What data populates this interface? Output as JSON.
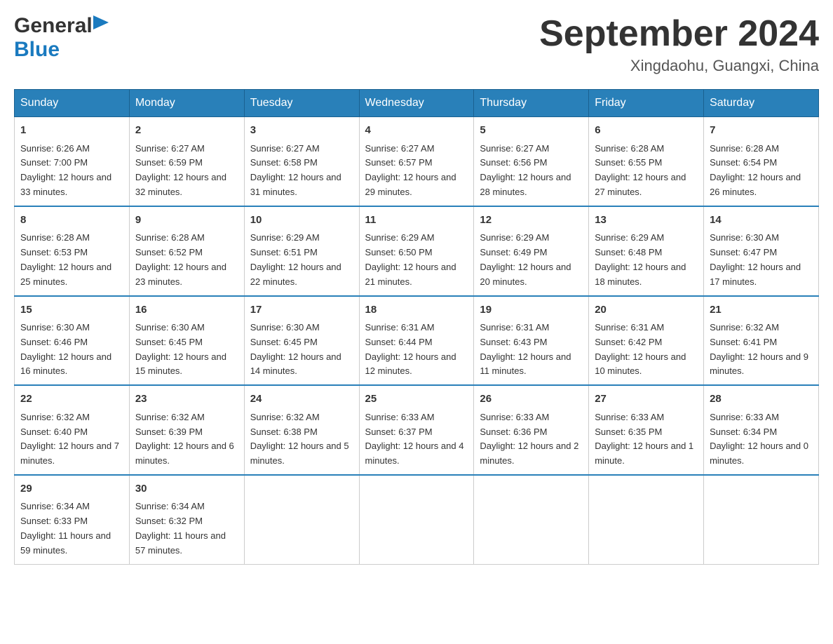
{
  "header": {
    "logo": {
      "general": "General",
      "blue": "Blue",
      "flag_unicode": "▶"
    },
    "title": "September 2024",
    "location": "Xingdaohu, Guangxi, China"
  },
  "days_of_week": [
    "Sunday",
    "Monday",
    "Tuesday",
    "Wednesday",
    "Thursday",
    "Friday",
    "Saturday"
  ],
  "weeks": [
    [
      {
        "day": "1",
        "sunrise": "6:26 AM",
        "sunset": "7:00 PM",
        "daylight": "12 hours and 33 minutes."
      },
      {
        "day": "2",
        "sunrise": "6:27 AM",
        "sunset": "6:59 PM",
        "daylight": "12 hours and 32 minutes."
      },
      {
        "day": "3",
        "sunrise": "6:27 AM",
        "sunset": "6:58 PM",
        "daylight": "12 hours and 31 minutes."
      },
      {
        "day": "4",
        "sunrise": "6:27 AM",
        "sunset": "6:57 PM",
        "daylight": "12 hours and 29 minutes."
      },
      {
        "day": "5",
        "sunrise": "6:27 AM",
        "sunset": "6:56 PM",
        "daylight": "12 hours and 28 minutes."
      },
      {
        "day": "6",
        "sunrise": "6:28 AM",
        "sunset": "6:55 PM",
        "daylight": "12 hours and 27 minutes."
      },
      {
        "day": "7",
        "sunrise": "6:28 AM",
        "sunset": "6:54 PM",
        "daylight": "12 hours and 26 minutes."
      }
    ],
    [
      {
        "day": "8",
        "sunrise": "6:28 AM",
        "sunset": "6:53 PM",
        "daylight": "12 hours and 25 minutes."
      },
      {
        "day": "9",
        "sunrise": "6:28 AM",
        "sunset": "6:52 PM",
        "daylight": "12 hours and 23 minutes."
      },
      {
        "day": "10",
        "sunrise": "6:29 AM",
        "sunset": "6:51 PM",
        "daylight": "12 hours and 22 minutes."
      },
      {
        "day": "11",
        "sunrise": "6:29 AM",
        "sunset": "6:50 PM",
        "daylight": "12 hours and 21 minutes."
      },
      {
        "day": "12",
        "sunrise": "6:29 AM",
        "sunset": "6:49 PM",
        "daylight": "12 hours and 20 minutes."
      },
      {
        "day": "13",
        "sunrise": "6:29 AM",
        "sunset": "6:48 PM",
        "daylight": "12 hours and 18 minutes."
      },
      {
        "day": "14",
        "sunrise": "6:30 AM",
        "sunset": "6:47 PM",
        "daylight": "12 hours and 17 minutes."
      }
    ],
    [
      {
        "day": "15",
        "sunrise": "6:30 AM",
        "sunset": "6:46 PM",
        "daylight": "12 hours and 16 minutes."
      },
      {
        "day": "16",
        "sunrise": "6:30 AM",
        "sunset": "6:45 PM",
        "daylight": "12 hours and 15 minutes."
      },
      {
        "day": "17",
        "sunrise": "6:30 AM",
        "sunset": "6:45 PM",
        "daylight": "12 hours and 14 minutes."
      },
      {
        "day": "18",
        "sunrise": "6:31 AM",
        "sunset": "6:44 PM",
        "daylight": "12 hours and 12 minutes."
      },
      {
        "day": "19",
        "sunrise": "6:31 AM",
        "sunset": "6:43 PM",
        "daylight": "12 hours and 11 minutes."
      },
      {
        "day": "20",
        "sunrise": "6:31 AM",
        "sunset": "6:42 PM",
        "daylight": "12 hours and 10 minutes."
      },
      {
        "day": "21",
        "sunrise": "6:32 AM",
        "sunset": "6:41 PM",
        "daylight": "12 hours and 9 minutes."
      }
    ],
    [
      {
        "day": "22",
        "sunrise": "6:32 AM",
        "sunset": "6:40 PM",
        "daylight": "12 hours and 7 minutes."
      },
      {
        "day": "23",
        "sunrise": "6:32 AM",
        "sunset": "6:39 PM",
        "daylight": "12 hours and 6 minutes."
      },
      {
        "day": "24",
        "sunrise": "6:32 AM",
        "sunset": "6:38 PM",
        "daylight": "12 hours and 5 minutes."
      },
      {
        "day": "25",
        "sunrise": "6:33 AM",
        "sunset": "6:37 PM",
        "daylight": "12 hours and 4 minutes."
      },
      {
        "day": "26",
        "sunrise": "6:33 AM",
        "sunset": "6:36 PM",
        "daylight": "12 hours and 2 minutes."
      },
      {
        "day": "27",
        "sunrise": "6:33 AM",
        "sunset": "6:35 PM",
        "daylight": "12 hours and 1 minute."
      },
      {
        "day": "28",
        "sunrise": "6:33 AM",
        "sunset": "6:34 PM",
        "daylight": "12 hours and 0 minutes."
      }
    ],
    [
      {
        "day": "29",
        "sunrise": "6:34 AM",
        "sunset": "6:33 PM",
        "daylight": "11 hours and 59 minutes."
      },
      {
        "day": "30",
        "sunrise": "6:34 AM",
        "sunset": "6:32 PM",
        "daylight": "11 hours and 57 minutes."
      },
      null,
      null,
      null,
      null,
      null
    ]
  ]
}
